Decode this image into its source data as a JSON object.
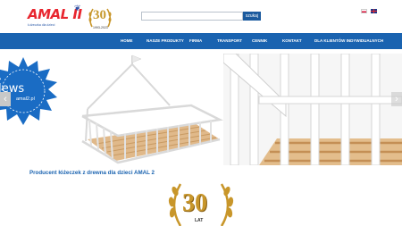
{
  "header": {
    "logo_text": "AMAL II",
    "logo_tagline": "Łóżeczka dla dzieci",
    "anniversary_number": "30",
    "anniversary_years": "1993-2023",
    "search_button": "szukaj",
    "search_placeholder": "",
    "languages": [
      "pl",
      "en"
    ]
  },
  "nav": {
    "items": [
      "HOME",
      "NASZE PRODUKTY",
      "FIRMA",
      "TRANSPORT",
      "CENNIK",
      "KONTAKT",
      "DLA KLIENTÓW INDYWIDUALNYCH"
    ]
  },
  "hero": {
    "badge_title": "News",
    "badge_subtitle": "amal2.pl"
  },
  "main": {
    "title": "Producent łóżeczek z drewna dla dzieci AMAL 2",
    "emblem_number": "30",
    "emblem_label": "LAT"
  },
  "colors": {
    "nav_blue": "#1a63b0",
    "logo_red": "#e8262f",
    "gold": "#c8962a"
  }
}
